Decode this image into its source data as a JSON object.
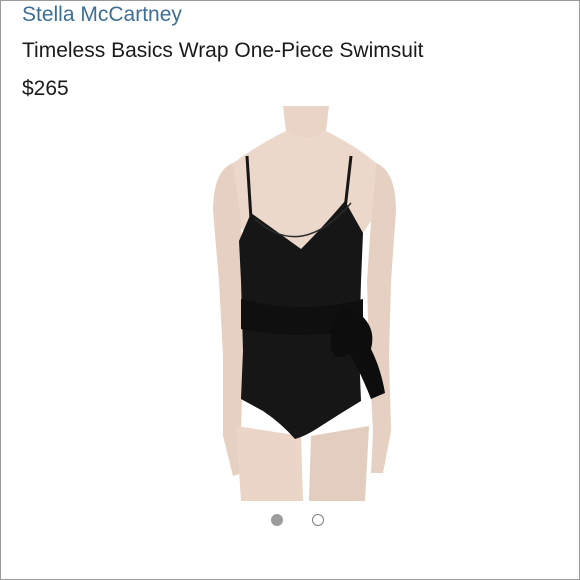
{
  "product": {
    "brand": "Stella McCartney",
    "title": "Timeless Basics Wrap One-Piece Swimsuit",
    "price": "$265"
  },
  "image": {
    "subject": "black wrap one-piece swimsuit with side tie, worn by model"
  },
  "carousel": {
    "total": 2,
    "active_index": 0
  },
  "colors": {
    "brand_link": "#3d6f95",
    "text": "#1a1a1a",
    "swimsuit": "#161616",
    "active_dot": "#9c9c9c"
  }
}
